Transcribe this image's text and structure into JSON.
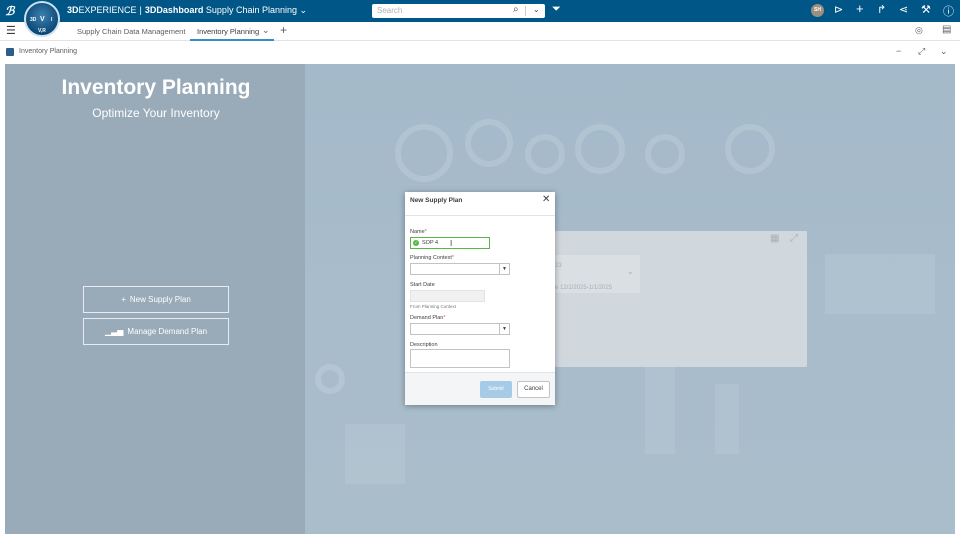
{
  "topbar": {
    "brand_prefix": "3D",
    "brand_rest": "EXPERIENCE",
    "product": "3DDashboard",
    "dashboard_name": "Supply Chain Planning",
    "search_placeholder": "Search",
    "avatar_initials": "SH",
    "compass": {
      "n": "3D",
      "play": "V",
      "e": "I",
      "s": "V,R"
    }
  },
  "tabs": [
    {
      "label": "Supply Chain Data Management"
    },
    {
      "label": "Inventory Planning"
    }
  ],
  "widget": {
    "title": "Inventory Planning"
  },
  "hero": {
    "title": "Inventory Planning",
    "subtitle": "Optimize Your Inventory"
  },
  "actions": {
    "new_supply_plan": "New Supply Plan",
    "manage_demand_plan": "Manage Demand Plan"
  },
  "bg_card": {
    "line1": "23",
    "line2": "e 12/1/2025-1/1/2025"
  },
  "dialog": {
    "title": "New Supply Plan",
    "name_label": "Name",
    "name_value": "SOP 4",
    "planning_context_label": "Planning Context",
    "planning_context_value": "",
    "start_date_label": "Start Date",
    "start_date_hint": "From Planning Context",
    "demand_plan_label": "Demand Plan",
    "demand_plan_value": "",
    "description_label": "Description",
    "required_mark": "*",
    "submit_label": "Submit",
    "cancel_label": "Cancel"
  },
  "colors": {
    "topbar": "#005686",
    "tab_active_underline": "#368ec4",
    "valid_green": "#57b847",
    "submit_disabled": "#a6cbe6"
  }
}
